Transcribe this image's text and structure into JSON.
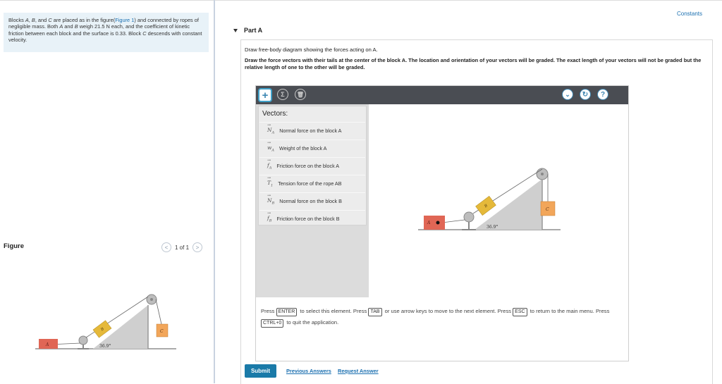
{
  "problem": {
    "segments": [
      {
        "text": "Blocks "
      },
      {
        "text": "A",
        "italic": true
      },
      {
        "text": ", "
      },
      {
        "text": "B",
        "italic": true
      },
      {
        "text": ", and "
      },
      {
        "text": "C",
        "italic": true
      },
      {
        "text": " are placed as in the figure("
      },
      {
        "text": "Figure 1",
        "link": true
      },
      {
        "text": ") and connected by ropes of negligible mass. Both "
      },
      {
        "text": "A",
        "italic": true
      },
      {
        "text": " and "
      },
      {
        "text": "B",
        "italic": true
      },
      {
        "text": " weigh 21.5 N each, and the coefficient of kinetic friction between each block and the surface is 0.33. Block "
      },
      {
        "text": "C",
        "italic": true
      },
      {
        "text": " descends with constant velocity."
      }
    ]
  },
  "figure": {
    "label": "Figure",
    "pager": "1 of 1",
    "angle_label": "36.9°",
    "block_a": "A",
    "block_b": "B",
    "block_c": "C"
  },
  "header": {
    "constants_link": "Constants",
    "part_label": "Part A"
  },
  "prompt": {
    "line1": "Draw free-body diagram showing the forces acting on A.",
    "line2": "Draw the force vectors with their tails at the center of the block A. The location and orientation of your vectors will be graded. The exact length of your vectors will not be graded but the relative length of one to the other will be graded."
  },
  "tool": {
    "vectors_title": "Vectors:",
    "vectors": [
      {
        "symbol": "N",
        "sub": "A",
        "label": "Normal force on the block A"
      },
      {
        "symbol": "w",
        "sub": "A",
        "label": "Weight of the block A"
      },
      {
        "symbol": "f",
        "sub": "A",
        "label": "Friction force on the block A"
      },
      {
        "symbol": "T",
        "sub": "1",
        "label": "Tension force of the rope AB"
      },
      {
        "symbol": "N",
        "sub": "B",
        "label": "Normal force on the block B"
      },
      {
        "symbol": "f",
        "sub": "B",
        "label": "Friction force on the block B"
      }
    ],
    "icons": [
      "plus-icon",
      "sigma-icon",
      "trash-icon",
      "chevron-down-icon",
      "reset-icon",
      "help-icon"
    ],
    "help_segments": [
      {
        "text": "Press "
      },
      {
        "text": "ENTER",
        "kbd": true
      },
      {
        "text": " to select this element. Press "
      },
      {
        "text": "TAB",
        "kbd": true
      },
      {
        "text": " or use arrow keys to move to the next element. Press "
      },
      {
        "text": "ESC",
        "kbd": true
      },
      {
        "text": " to return to the main menu. Press "
      },
      {
        "text": "CTRL+0",
        "kbd": true
      },
      {
        "text": " to quit the application."
      }
    ]
  },
  "footer": {
    "submit": "Submit",
    "previous_answers": "Previous Answers",
    "request_answer": "Request Answer"
  },
  "colors": {
    "accent": "#1a7aa8",
    "link": "#1a6fb0",
    "block_a": "#e06655",
    "block_b": "#e5b93a",
    "block_c": "#f2a65a",
    "incline": "#cfcfcf",
    "toolbar": "#4a4d53"
  }
}
